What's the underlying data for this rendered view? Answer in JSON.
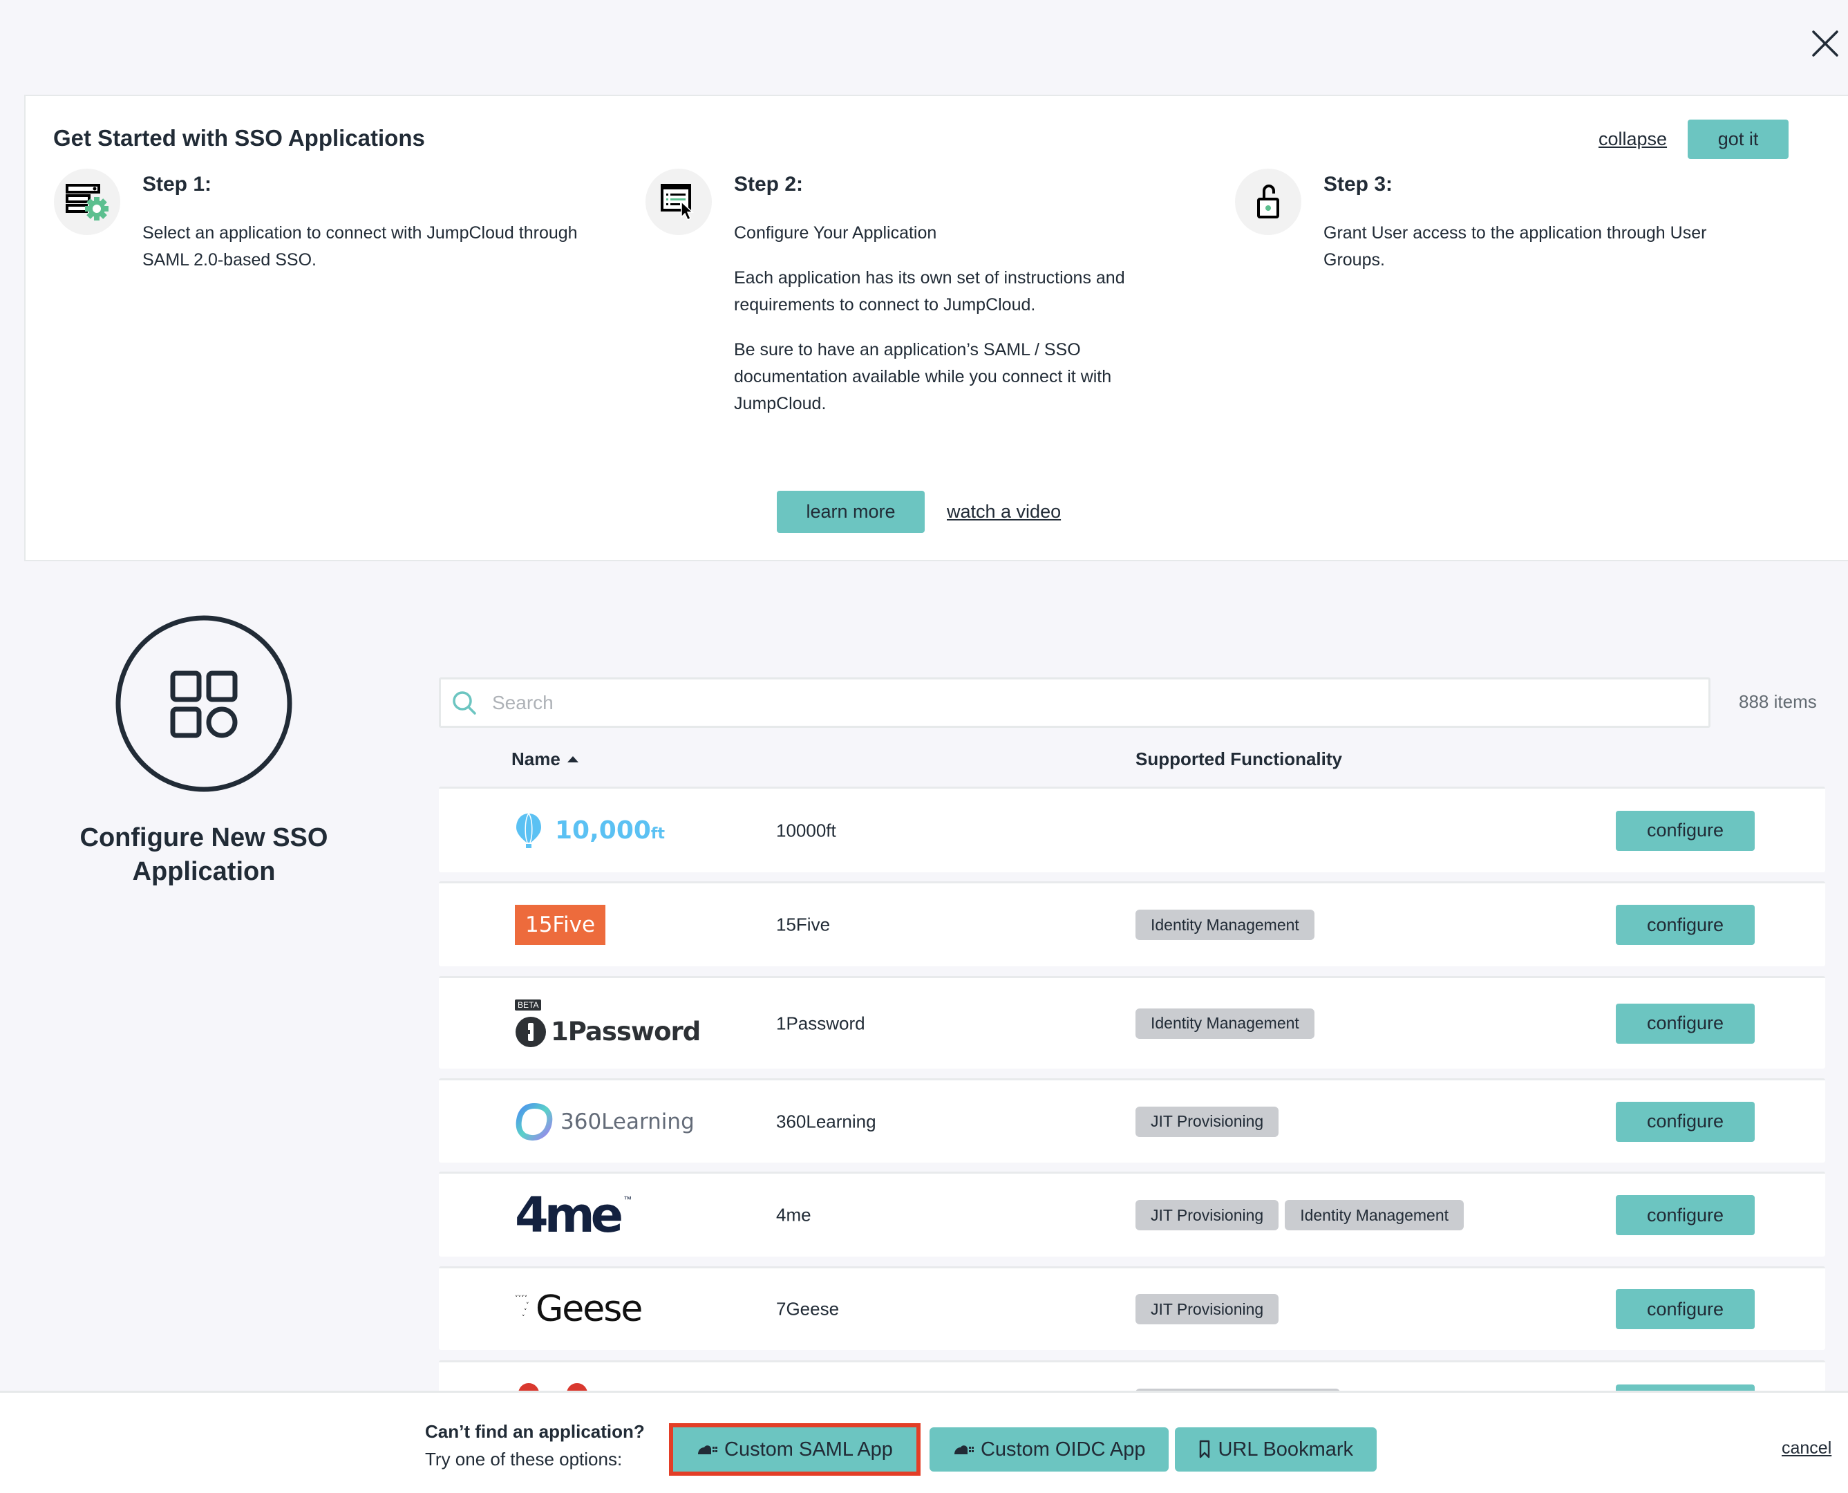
{
  "close": {
    "icon": "close-icon"
  },
  "banner": {
    "title": "Get Started with SSO Applications",
    "collapse_label": "collapse",
    "got_it_label": "got it",
    "steps": [
      {
        "heading": "Step 1:",
        "icon": "server-gear-icon",
        "paragraphs": [
          "Select an application to connect with JumpCloud through SAML 2.0-based SSO."
        ]
      },
      {
        "heading": "Step 2:",
        "icon": "configure-cursor-icon",
        "paragraphs": [
          "Configure Your Application",
          "Each application has its own set of instructions and requirements to connect to JumpCloud.",
          "Be sure to have an application’s SAML / SSO documentation available while you connect it with JumpCloud."
        ]
      },
      {
        "heading": "Step 3:",
        "icon": "unlock-icon",
        "paragraphs": [
          "Grant User access to the application through User Groups."
        ]
      }
    ],
    "learn_more_label": "learn more",
    "watch_video_label": "watch a video"
  },
  "left_panel": {
    "icon": "apps-grid-icon",
    "title": "Configure New SSO Application"
  },
  "search": {
    "placeholder": "Search",
    "value": "",
    "count_label": "888 items"
  },
  "list": {
    "columns": {
      "name": "Name",
      "functionality": "Supported Functionality"
    },
    "sort": {
      "column": "Name",
      "direction": "ascending"
    },
    "configure_label": "configure",
    "rows": [
      {
        "logo_text": "10,000",
        "logo_suffix": "ft",
        "name": "10000ft",
        "tags": []
      },
      {
        "logo_text": "15Five",
        "name": "15Five",
        "tags": [
          "Identity Management"
        ]
      },
      {
        "logo_text": "1Password",
        "badge": "BETA",
        "name": "1Password",
        "tags": [
          "Identity Management"
        ]
      },
      {
        "logo_text": "360Learning",
        "name": "360Learning",
        "tags": [
          "JIT Provisioning"
        ]
      },
      {
        "logo_text": "4me",
        "logo_tm": "™",
        "name": "4me",
        "tags": [
          "JIT Provisioning",
          "Identity Management"
        ]
      },
      {
        "logo_text": "Geese",
        "name": "7Geese",
        "tags": [
          "JIT Provisioning"
        ]
      }
    ]
  },
  "footer": {
    "question": "Can’t find an application?",
    "hint": "Try one of these options:",
    "buttons": [
      {
        "label": "Custom SAML App",
        "icon": "cloud-app-icon",
        "highlighted": true
      },
      {
        "label": "Custom OIDC App",
        "icon": "cloud-app-icon",
        "highlighted": false
      },
      {
        "label": "URL Bookmark",
        "icon": "bookmark-icon",
        "highlighted": false
      }
    ],
    "cancel_label": "cancel"
  },
  "colors": {
    "accent": "#6cc5c1",
    "text": "#212b36",
    "tag_bg": "#caccd0",
    "highlight": "#e33e27",
    "page_bg": "#f6f6fa"
  }
}
